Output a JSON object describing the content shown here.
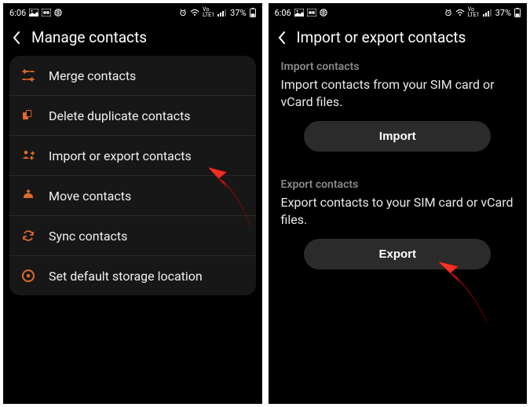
{
  "status": {
    "time": "6:06",
    "battery": "37%",
    "network": "VoLTE1"
  },
  "left": {
    "title": "Manage contacts",
    "items": [
      {
        "label": "Merge contacts"
      },
      {
        "label": "Delete duplicate contacts"
      },
      {
        "label": "Import or export contacts"
      },
      {
        "label": "Move contacts"
      },
      {
        "label": "Sync contacts"
      },
      {
        "label": "Set default storage location"
      }
    ]
  },
  "right": {
    "title": "Import or export contacts",
    "import": {
      "heading": "Import contacts",
      "desc": "Import contacts from your SIM card or vCard files.",
      "button": "Import"
    },
    "export": {
      "heading": "Export contacts",
      "desc": "Export contacts to your SIM card or vCard files.",
      "button": "Export"
    }
  }
}
